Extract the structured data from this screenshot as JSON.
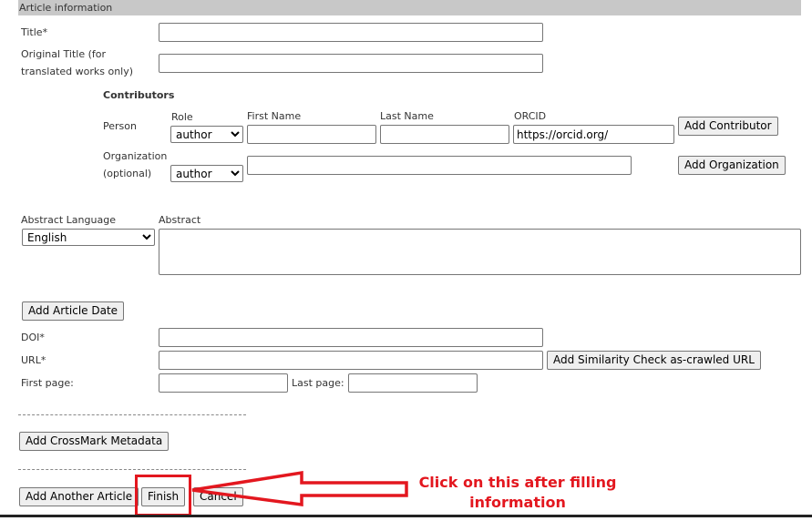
{
  "section": {
    "title": "Article information"
  },
  "fields": {
    "title_label": "Title*",
    "title_value": "",
    "original_title_label_line1": "Original Title (for",
    "original_title_label_line2": "translated works only)",
    "original_title_value": ""
  },
  "contributors": {
    "heading": "Contributors",
    "person_label": "Person",
    "role_label": "Role",
    "first_name_label": "First Name",
    "last_name_label": "Last Name",
    "orcid_label": "ORCID",
    "person_role_value": "author",
    "orcid_value": "https://orcid.org/",
    "add_contributor_label": "Add Contributor",
    "organization_label_line1": "Organization",
    "organization_label_line2": "(optional)",
    "organization_role_value": "author",
    "add_organization_label": "Add Organization"
  },
  "abstract": {
    "language_label": "Abstract Language",
    "language_value": "English",
    "abstract_label": "Abstract"
  },
  "dates": {
    "add_article_date_label": "Add Article Date"
  },
  "identifiers": {
    "doi_label": "DOI*",
    "url_label": "URL*",
    "add_similarity_label": "Add Similarity Check as-crawled URL",
    "first_page_label": "First page:",
    "last_page_label": "Last page:"
  },
  "crossmark": {
    "add_crossmark_label": "Add CrossMark Metadata"
  },
  "actions": {
    "add_another_article_label": "Add Another Article",
    "finish_label": "Finish",
    "cancel_label": "Cancel"
  },
  "annotation": {
    "line1": "Click on this after filling",
    "line2": "information",
    "color": "#e3171f"
  }
}
